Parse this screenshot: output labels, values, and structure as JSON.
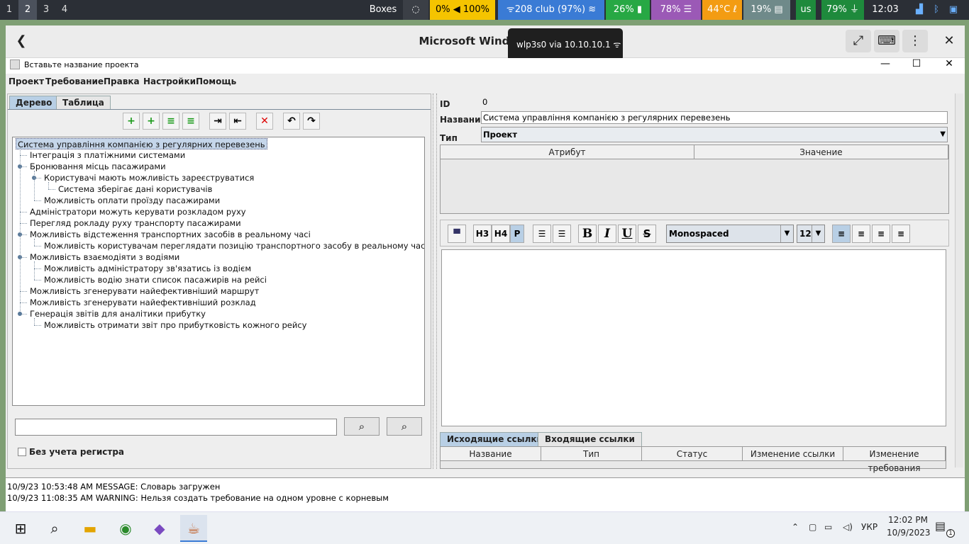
{
  "topbar": {
    "workspaces": [
      "1",
      "2",
      "3",
      "4"
    ],
    "active_workspace": "2",
    "boxes": "Boxes",
    "volume": "0% ◀ 100%",
    "network": "ᯤ208 club (97%)",
    "cpu": "26%",
    "mem": "78% ☰",
    "temp": "44°C",
    "disk": "19%",
    "lang": "us",
    "battery": "79%",
    "time": "12:03"
  },
  "chrome": {
    "title": "Microsoft Windows 11",
    "tooltip": "wlp3s0 via 10.10.10.1"
  },
  "app": {
    "title": "Вставьте название проекта",
    "menus": [
      "Проект",
      "Требование",
      "Правка",
      "Настройки",
      "Помощь"
    ],
    "tabs": [
      "Дерево",
      "Таблица"
    ],
    "tree": [
      {
        "text": "Система управління компанією з регулярних перевезень",
        "level": 0,
        "selected": true
      },
      {
        "text": "Інтеграція з платіжними системами",
        "level": 1
      },
      {
        "text": "Бронювання місць пасажирами",
        "level": 1,
        "knob": true
      },
      {
        "text": "Користувачі мають можливість зареєструватися",
        "level": 2,
        "knob": true
      },
      {
        "text": "Система зберігає дані користувачів",
        "level": 3
      },
      {
        "text": "Можливість оплати проїзду пасажирами",
        "level": 2
      },
      {
        "text": "Адміністратори можуть керувати розкладом руху",
        "level": 1
      },
      {
        "text": "Перегляд рокладу руху транспорту пасажирами",
        "level": 1
      },
      {
        "text": "Можливість відстеження транспортних засобів в реальному часі",
        "level": 1,
        "knob": true
      },
      {
        "text": "Можливість користувачам переглядати позицію транспортного засобу в реальному часі",
        "level": 2
      },
      {
        "text": "Можливість взаємодіяти з водіями",
        "level": 1,
        "knob": true
      },
      {
        "text": "Можливість адміністратору зв'язатись із водієм",
        "level": 2
      },
      {
        "text": "Можливість водію знати список пасажирів на рейсі",
        "level": 2
      },
      {
        "text": "Можливість згенерувати найефективніший маршрут",
        "level": 1
      },
      {
        "text": "Можливість згенерувати найефективніший розклад",
        "level": 1
      },
      {
        "text": "Генерація звітів для аналітики прибутку",
        "level": 1,
        "knob": true
      },
      {
        "text": "Можливість отримати звіт про прибутковість кожного рейсу",
        "level": 2
      }
    ],
    "case_label": "Без учета регистра",
    "fields": {
      "id_label": "ID",
      "id_value": "0",
      "name_label": "Название",
      "name_value": "Система управління компанією з регулярних перевезень",
      "type_label": "Тип",
      "type_value": "Проект"
    },
    "attr_headers": [
      "Атрибут",
      "Значение"
    ],
    "editor": {
      "h3": "H3",
      "h4": "H4",
      "p": "P",
      "bold": "B",
      "italic": "I",
      "underline": "U",
      "strike": "S",
      "font": "Monospaced",
      "size": "12"
    },
    "link_tabs": [
      "Исходящие ссылки",
      "Входящие ссылки"
    ],
    "link_headers": [
      "Название",
      "Тип",
      "Статус",
      "Изменение ссылки",
      "Изменение требования"
    ],
    "log": [
      "10/9/23 10:53:48 AM MESSAGE: Словарь загружен",
      "10/9/23 11:08:35 AM WARNING: Нельзя создать требование на одном уровне с корневым"
    ]
  },
  "taskbar": {
    "lang": "УКР",
    "time": "12:02 PM",
    "date": "10/9/2023",
    "notifications": "1"
  },
  "colors": {
    "yellow": "#f5c400",
    "blue": "#3a7bd5",
    "green": "#27a844",
    "purple": "#9b59b6",
    "orange": "#f39c12",
    "teal": "#6f8a8a",
    "darkgreen": "#1e8a3c"
  }
}
